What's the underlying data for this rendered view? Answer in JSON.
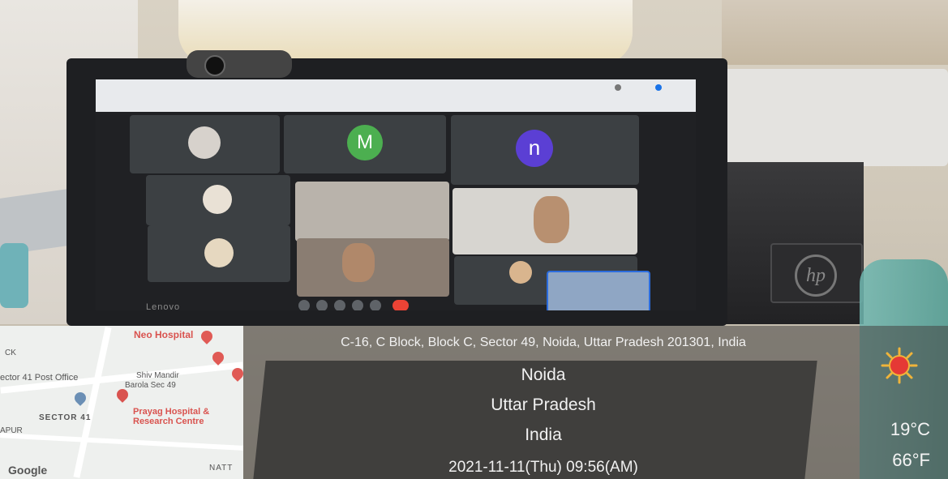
{
  "screen": {
    "participants": [
      {
        "initial": "M",
        "color": "#4caf50"
      },
      {
        "initial": "n",
        "color": "#5b3fd4"
      }
    ],
    "monitor_brand": "Lenovo"
  },
  "map": {
    "labels": {
      "neo_hospital": "Neo Hospital",
      "sector41_post_office": "ector 41 Post Office",
      "shiv_mandir": "Shiv Mandir",
      "barola": "Barola Sec 49",
      "prayag": "Prayag Hospital &",
      "research": "Research Centre",
      "sector41": "SECTOR 41",
      "apur": "APUR",
      "ck": "CK",
      "natt": "NATT"
    },
    "logo": "Google"
  },
  "location": {
    "address": "C-16, C Block, Block C, Sector 49, Noida, Uttar Pradesh 201301, India",
    "city": "Noida",
    "state": "Uttar Pradesh",
    "country": "India",
    "datetime": "2021-11-11(Thu)  09:56(AM)"
  },
  "weather": {
    "celsius": "19°C",
    "fahrenheit": "66°F",
    "icon": "sun-icon"
  }
}
